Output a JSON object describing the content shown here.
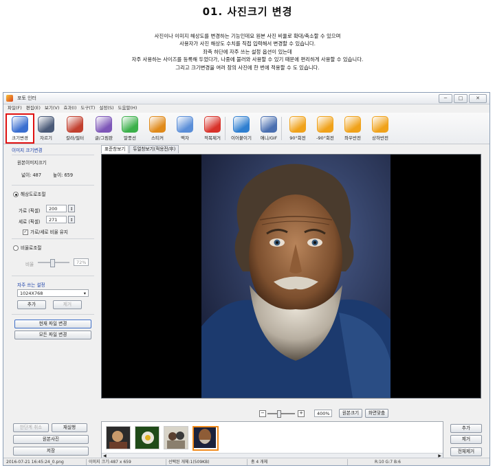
{
  "heading": "01. 사진크기 변경",
  "intro_lines": [
    "사진이나 이미지 해상도를 변경하는 기능인데요 원본 사진 비율로 확대/축소할 수 있으며",
    "사용자가  사진 해상도 수치를 직접 입력해서 변경할 수 있습니다.",
    "좌측 하단에 자주 쓰는 설정 옵션이 있는데",
    "자주 사용하는 사이즈를  등록해 두었다가, 나중에  불러와 사용할 수 있기 때문에 편리하게 사용할 수 있습니다.",
    "그리고 크기변경을 여러 장의 사진에  한 번에 적용할 수 도 있습니다."
  ],
  "window": {
    "title": "포토 인터",
    "buttons": {
      "minimize": "─",
      "maximize": "□",
      "close": "✕"
    }
  },
  "menu": [
    "파일(F)",
    "편집(E)",
    "보기(V)",
    "효과(I)",
    "도구(T)",
    "설정(S)",
    "도움말(H)"
  ],
  "toolbar": [
    {
      "label": "크기변경",
      "icon": "resize-icon",
      "color": "#3a6fd0",
      "selected": true
    },
    {
      "label": "자르기",
      "icon": "crop-icon",
      "color": "#4a5a78"
    },
    {
      "label": "칼라/필터",
      "icon": "color-filter-icon",
      "color": "#c2402f"
    },
    {
      "label": "글/그림판",
      "icon": "text-paint-icon",
      "color": "#7d56b8"
    },
    {
      "label": "말풍선",
      "icon": "speech-bubble-icon",
      "color": "#3bb04a"
    },
    {
      "label": "스티커",
      "icon": "sticker-icon",
      "color": "#e08a1a"
    },
    {
      "label": "액자",
      "icon": "frame-icon",
      "color": "#5a8ed8"
    },
    {
      "label": "적목제거",
      "icon": "redeye-icon",
      "color": "#d8322a"
    },
    {
      "label": "이어붙이기",
      "icon": "merge-icon",
      "color": "#2f7fd0"
    },
    {
      "label": "애니/GIF",
      "icon": "gif-icon",
      "color": "#4a6fb0"
    },
    {
      "label": "90°회전",
      "icon": "rotate-cw-icon",
      "color": "#f0a21a"
    },
    {
      "label": "-90°회전",
      "icon": "rotate-ccw-icon",
      "color": "#f0a21a"
    },
    {
      "label": "좌우반전",
      "icon": "flip-horizontal-icon",
      "color": "#f0a21a"
    },
    {
      "label": "상하반전",
      "icon": "flip-vertical-icon",
      "color": "#f0a21a"
    }
  ],
  "panel": {
    "header": "이미지 크기변경",
    "original_label": "원본이미지크기",
    "width_label": "넓이: 487",
    "height_label": "높이: 659",
    "resolution_option": "해상도로조절",
    "width_field_label": "가로 (픽셀)",
    "width_value": "200",
    "height_field_label": "세로 (픽셀)",
    "height_value": "271",
    "keep_ratio_label": "가로/세로 비율 유지",
    "ratio_option": "비율로조절",
    "ratio_label": "비율",
    "ratio_value": "72%",
    "favorites_header": "자주 쓰는 설정",
    "favorite_selected": "1024X768",
    "add_button": "추가",
    "remove_button": "제거",
    "apply_current": "현재 파일 변경",
    "apply_all": "모든 파일 변경"
  },
  "bottom_left": {
    "undo": "한단계 취소",
    "redo": "재실행",
    "original": "원본사진",
    "save": "저장"
  },
  "tabs": [
    "표준창보기",
    "듀얼창보기(적용전/후)"
  ],
  "zoom": {
    "value": "400%",
    "original_size": "원본크기",
    "fit": "화면맞춤"
  },
  "thumb_buttons": {
    "add": "추가",
    "remove": "제거",
    "remove_all": "전체제거"
  },
  "status": {
    "filename": "2016-07-21 16:45:24_0.png",
    "image_size": "이미지 크기:487 x 659",
    "selected": "선택된 개체:1(509KB)",
    "total": "총 4 개체",
    "rgb": "R:10 G:7 B:6"
  },
  "colors": {
    "accent": "#1a3fa8",
    "selected_outline": "#e01010",
    "thumb_selected": "#f08a1c"
  }
}
